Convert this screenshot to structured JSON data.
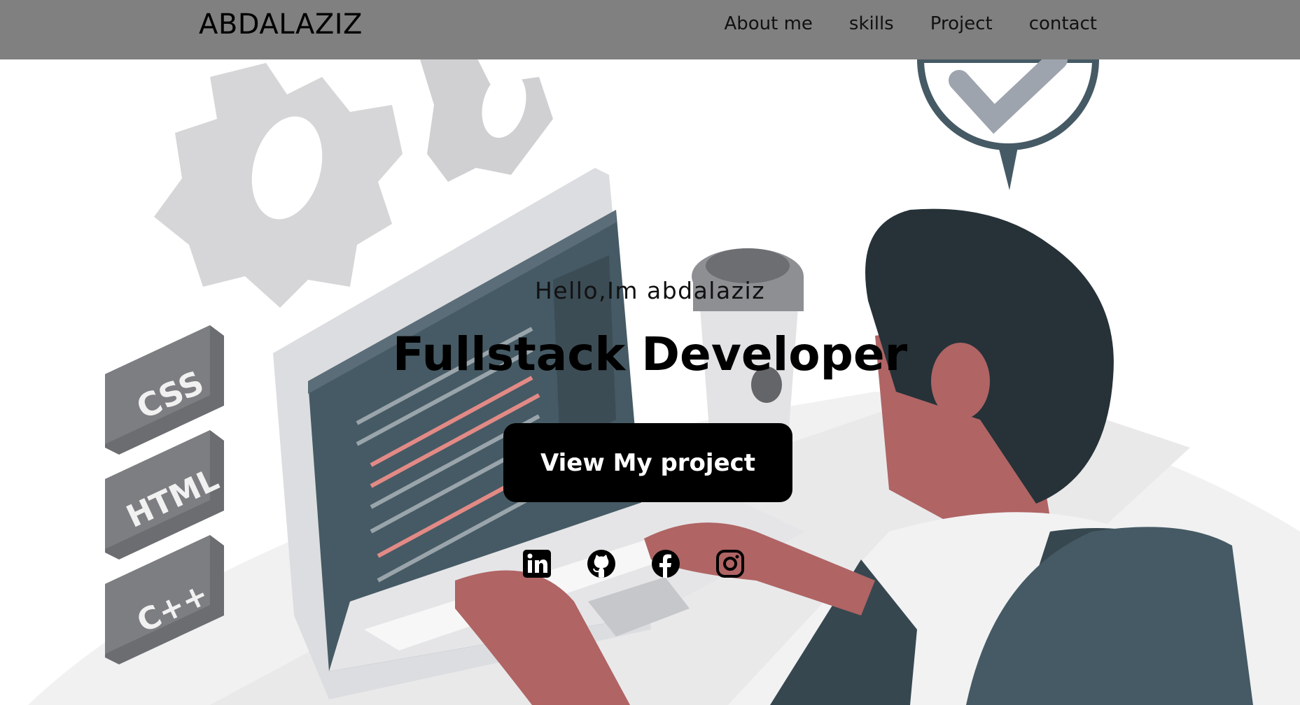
{
  "nav": {
    "brand": "ABDALAZIZ",
    "links": [
      "About me",
      "skills",
      "Project",
      "contact"
    ]
  },
  "illustration": {
    "badges": [
      "CSS",
      "HTML",
      "C++"
    ]
  },
  "hero": {
    "greeting": "Hello,Im abdalaziz",
    "role": "Fullstack Developer",
    "cta_label": "View My project"
  },
  "socials": [
    "linkedin-icon",
    "github-icon",
    "facebook-icon",
    "instagram-icon"
  ],
  "colors": {
    "navbar": "#808080",
    "button": "#000000",
    "skin": "#b06464",
    "hair": "#263238",
    "screen": "#455a64"
  }
}
